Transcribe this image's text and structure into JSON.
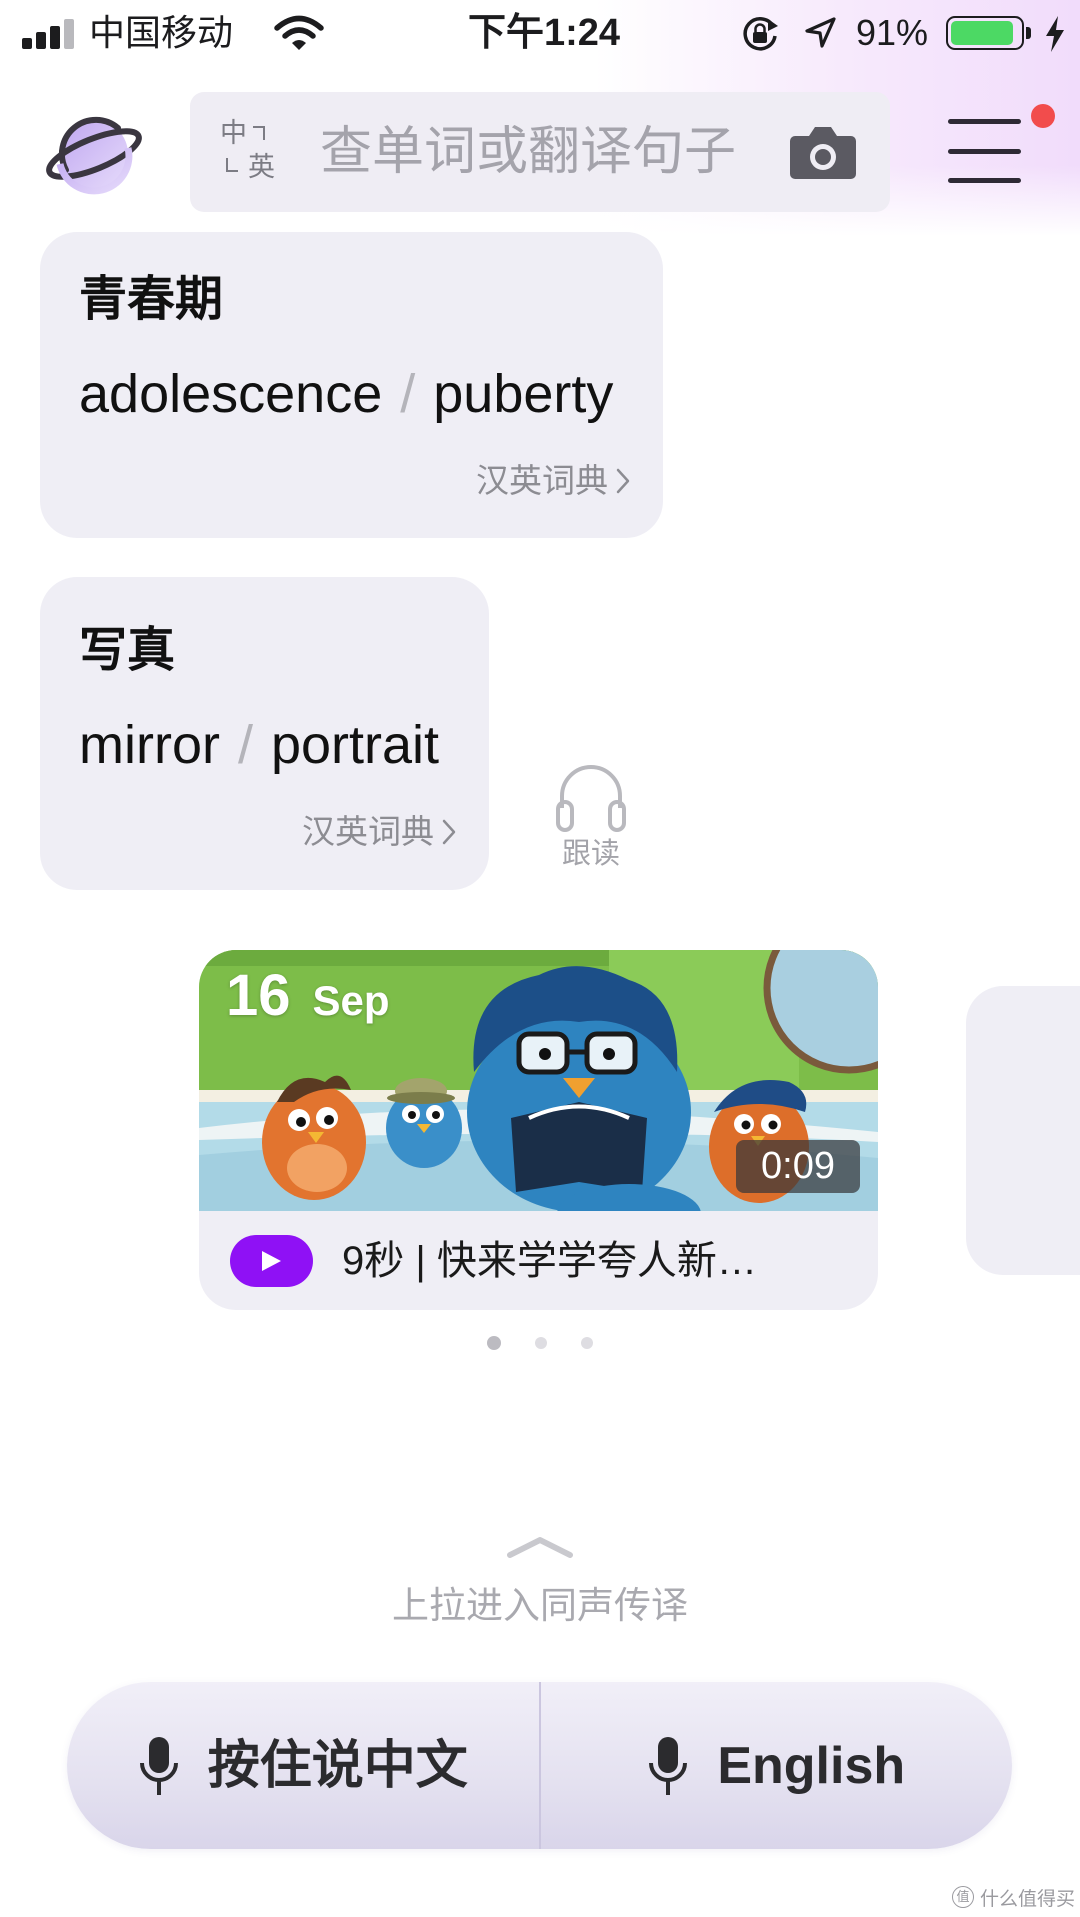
{
  "status_bar": {
    "carrier": "中国移动",
    "time": "下午1:24",
    "battery_text": "91%",
    "battery_level": 0.91,
    "icons": [
      "signal-icon",
      "wifi-icon",
      "rotation-lock-icon",
      "location-icon",
      "battery-icon",
      "charging-icon"
    ]
  },
  "header": {
    "lang_from": "中",
    "lang_to": "英",
    "search_placeholder": "查单词或翻译句子",
    "icons": [
      "planet-logo-icon",
      "camera-icon",
      "menu-icon"
    ]
  },
  "cards": [
    {
      "title": "青春期",
      "translations": [
        "adolescence",
        "puberty"
      ],
      "separator": "/",
      "link": "汉英词典"
    },
    {
      "title": "写真",
      "translations": [
        "mirror",
        "portrait"
      ],
      "separator": "/",
      "link": "汉英词典"
    }
  ],
  "follow_read": {
    "label": "跟读",
    "icon": "headphones-icon"
  },
  "video": {
    "day": "16",
    "month": "Sep",
    "duration": "0:09",
    "caption": "9秒 | 快来学学夸人新…"
  },
  "pagination": {
    "count": 3,
    "active": 0
  },
  "pull_hint": "上拉进入同声传译",
  "voice_bar": {
    "left_label": "按住说中文",
    "right_label": "English",
    "icon": "microphone-icon"
  },
  "watermark": {
    "glyph": "值",
    "text": "什么值得买"
  },
  "colors": {
    "accent": "#8f11f5",
    "card_bg": "#efeef5",
    "battery": "#4cd964",
    "notification_dot": "#f24c4c"
  }
}
